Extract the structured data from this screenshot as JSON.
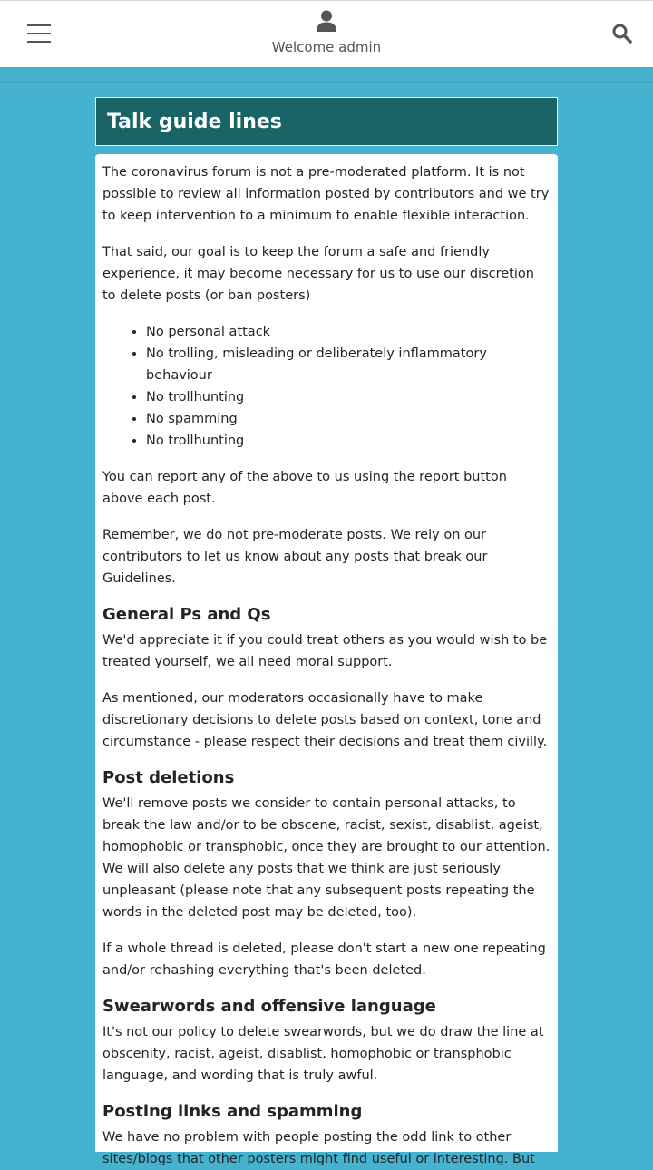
{
  "header": {
    "menu_icon": "hamburger-icon",
    "user_icon": "user-icon",
    "welcome_text": "Welcome admin",
    "search_icon": "search-icon"
  },
  "page": {
    "title": "Talk guide lines"
  },
  "content": {
    "intro_p1": "The coronavirus forum is not a pre-moderated platform. It is not possible to review all information posted by contributors and we try to keep intervention to a minimum to enable flexible interaction.",
    "intro_p2": "That said, our goal is to keep the forum a safe and friendly experience, it may become necessary for us to use our discretion to delete posts (or ban posters)",
    "rules": [
      "No personal attack",
      "No trolling, misleading or deliberately inflammatory behaviour",
      "No trollhunting",
      "No spamming",
      "No trollhunting"
    ],
    "report_p": "You can report any of the above to us using the report button above each post.",
    "remember_p": "Remember, we do not pre-moderate posts. We rely on our contributors to let us know about any posts that break our Guidelines.",
    "section1_heading": "General Ps and Qs",
    "section1_p1": "We'd appreciate it if you could treat others as you would wish to be treated yourself, we all need moral support.",
    "section1_p2": "As mentioned, our moderators occasionally have to make discretionary decisions to delete posts based on context, tone and circumstance - please respect their decisions and treat them civilly.",
    "section2_heading": "Post deletions",
    "section2_p1": "We'll remove posts we consider to contain personal attacks, to break the law and/or to be obscene, racist, sexist, disablist, ageist, homophobic or transphobic, once they are brought to our attention. We will also delete any posts that we think are just seriously unpleasant (please note that any subsequent posts repeating the words in the deleted post may be deleted, too).",
    "section2_p2": "If a whole thread is deleted, please don't start a new one repeating and/or rehashing everything that's been deleted.",
    "section3_heading": "Swearwords and offensive language",
    "section3_p1": "It's not our policy to delete swearwords, but we do draw the line at obscenity, racist, ageist, disablist, homophobic or transphobic language, and wording that is truly awful.",
    "section4_heading": "Posting links and spamming",
    "section4_p1": "We have no problem with people posting the odd link to other sites/blogs that other posters might find useful or interesting. But"
  },
  "colors": {
    "background": "#45b3cf",
    "title_bar": "#1a6467",
    "header_bg": "#ffffff"
  }
}
